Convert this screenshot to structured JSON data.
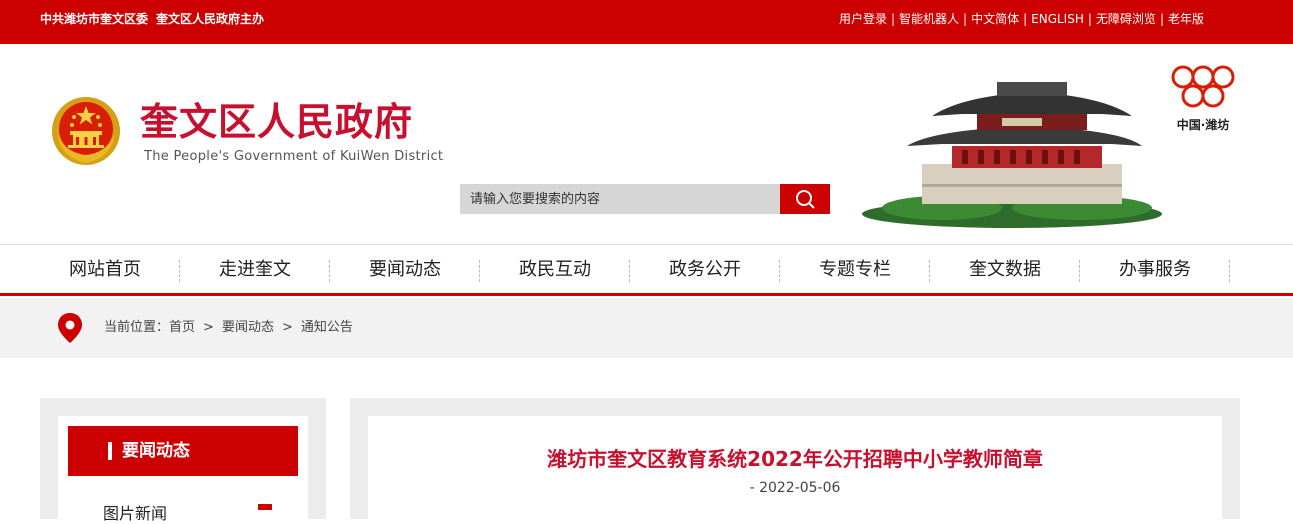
{
  "topbar": {
    "host": "中共潍坊市奎文区委",
    "sponsor": "奎文区人民政府主办",
    "links": [
      "用户登录",
      "智能机器人",
      "中文简体",
      "ENGLISH",
      "无障碍浏览",
      "老年版"
    ]
  },
  "header": {
    "title": "奎文区人民政府",
    "subtitle": "The People's Government of KuiWen District",
    "weifang_label": "中国·潍坊"
  },
  "search": {
    "placeholder": "请输入您要搜索的内容"
  },
  "nav": {
    "items": [
      "网站首页",
      "走进奎文",
      "要闻动态",
      "政民互动",
      "政务公开",
      "专题专栏",
      "奎文数据",
      "办事服务"
    ]
  },
  "breadcrumb": {
    "prefix": "当前位置：",
    "items": [
      "首页",
      "要闻动态",
      "通知公告"
    ]
  },
  "sidebar": {
    "heading": "要闻动态",
    "items": [
      "图片新闻"
    ]
  },
  "article": {
    "title": "潍坊市奎文区教育系统2022年公开招聘中小学教师简章",
    "date": "- 2022-05-06"
  },
  "colors": {
    "brand_red": "#cc0000",
    "title_red": "#c8102e"
  }
}
